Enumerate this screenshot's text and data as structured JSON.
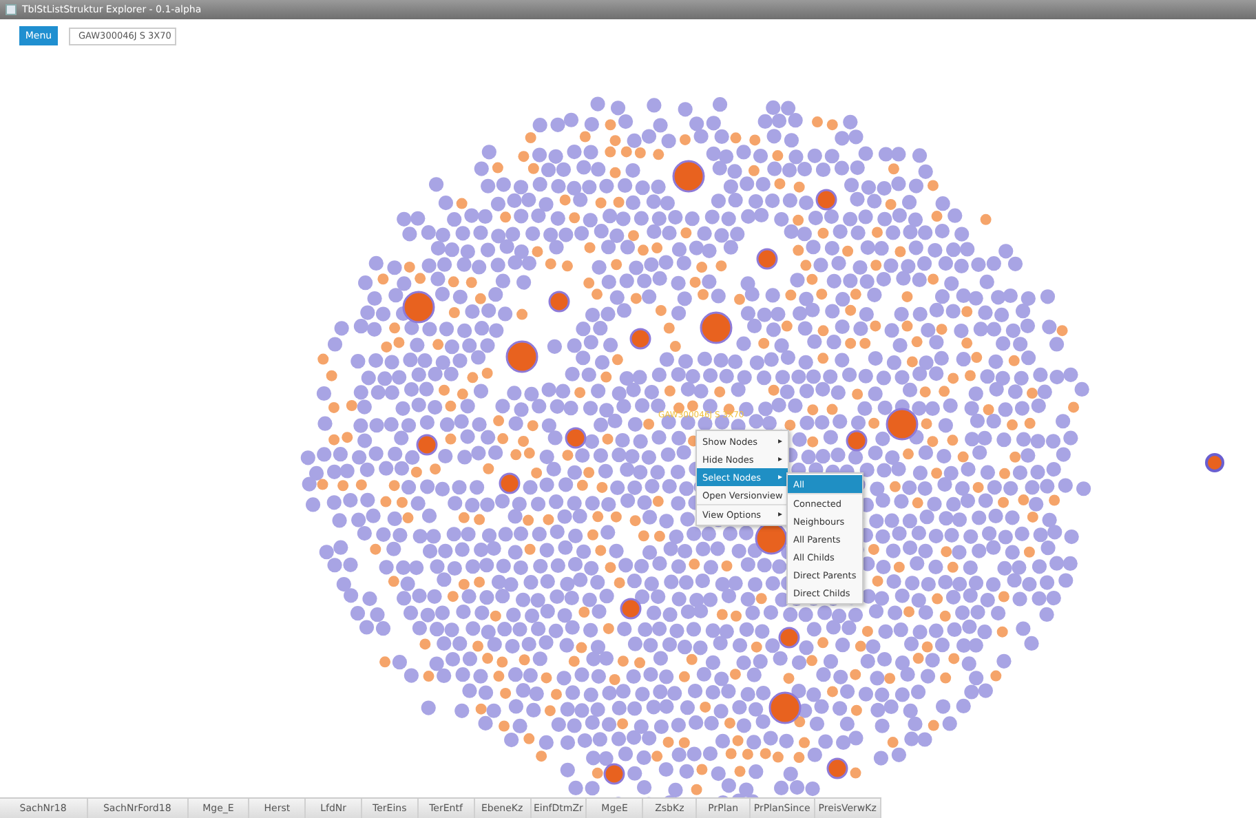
{
  "window": {
    "title": "TblStListStruktur Explorer - 0.1-alpha"
  },
  "toolbar": {
    "menu_button": "Menu",
    "search": {
      "value": "GAW300046J S 3X70"
    }
  },
  "graph": {
    "node_label": "GAW300046J S 3X70"
  },
  "context_menu": {
    "items": [
      {
        "label": "Show Nodes",
        "submenu_arrow": "▸",
        "selected": false
      },
      {
        "label": "Hide Nodes",
        "submenu_arrow": "▸",
        "selected": false
      },
      {
        "label": "Select Nodes",
        "submenu_arrow": "▸",
        "selected": true
      },
      {
        "label": "Open Versionview",
        "selected": false
      },
      {
        "label": "View Options",
        "submenu_arrow": "▸",
        "selected": false
      }
    ],
    "submenu": [
      {
        "label": "All",
        "selected": true
      },
      {
        "label": "Connected",
        "selected": false
      },
      {
        "label": "Neighbours",
        "selected": false
      },
      {
        "label": "All Parents",
        "selected": false
      },
      {
        "label": "All Childs",
        "selected": false
      },
      {
        "label": "Direct Parents",
        "selected": false
      },
      {
        "label": "Direct Childs",
        "selected": false
      }
    ]
  },
  "columns": [
    "SachNr18",
    "SachNrFord18",
    "Mge_E",
    "Herst",
    "LfdNr",
    "TerEins",
    "TerEntf",
    "EbeneKz",
    "EinfDtmZr",
    "MgeE",
    "ZsbKz",
    "PrPlan",
    "PrPlanSince",
    "PreisVerwKz"
  ]
}
